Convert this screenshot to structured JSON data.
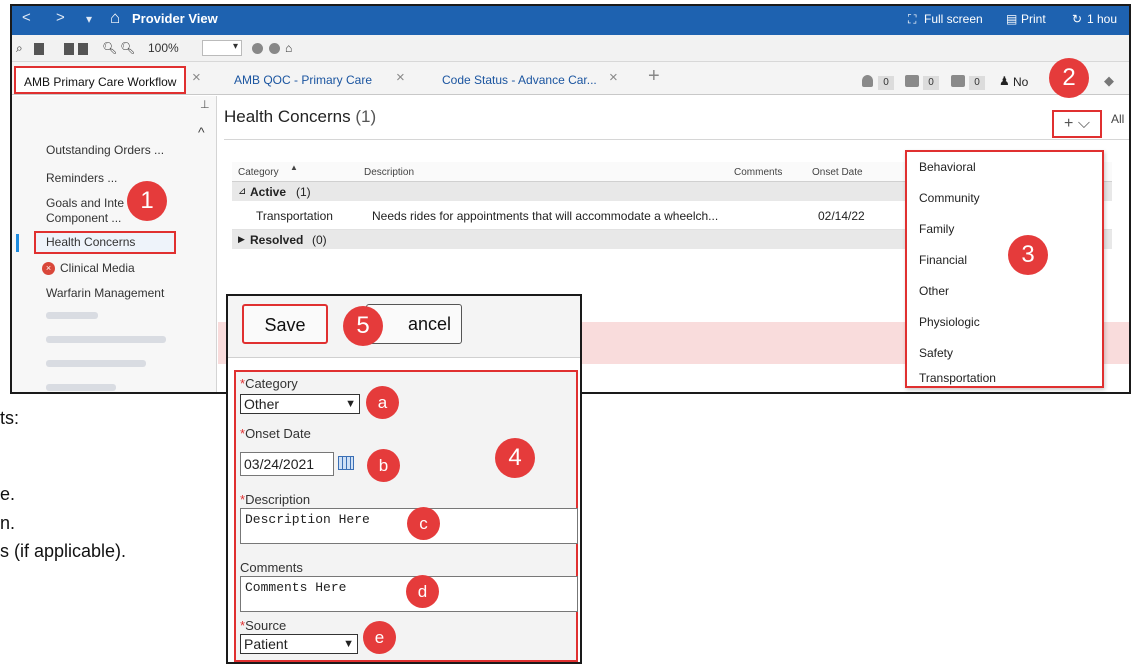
{
  "title_bar": {
    "back_glyph": "<",
    "forward_glyph": ">",
    "menu_glyph": "▾",
    "home_glyph": "⌂",
    "title": "Provider View",
    "full_screen": "Full screen",
    "print": "Print",
    "refresh": "1 hou"
  },
  "toolbar": {
    "zoom": "100%"
  },
  "tabs": [
    {
      "label": "AMB Primary Care Workflow",
      "active": true
    },
    {
      "label": "AMB QOC - Primary Care",
      "active": false
    },
    {
      "label": "Code Status - Advance Car...",
      "active": false
    }
  ],
  "tab_close": "×",
  "tab_add": "+",
  "notifications": [
    {
      "icon": "bell-icon",
      "count": "0"
    },
    {
      "icon": "message-icon",
      "count": "0"
    },
    {
      "icon": "inbox-icon",
      "count": "0"
    }
  ],
  "user_truncated": "No",
  "left_nav": {
    "pin_glyph": "⊥",
    "collapse_glyph": "^",
    "items": [
      "Outstanding Orders ...",
      "Reminders ...",
      "Goals and Inte",
      "Component ...",
      "Health Concerns",
      "Clinical Media",
      "Warfarin Management"
    ]
  },
  "health_concerns": {
    "title": "Health Concerns",
    "count": "(1)",
    "add_glyph": "+ ⌵",
    "filter": "All",
    "columns": [
      "Category",
      "Description",
      "Comments",
      "Onset Date"
    ],
    "active_group": {
      "label": "Active",
      "count": "(1)"
    },
    "row": {
      "category": "Transportation",
      "description": "Needs rides for appointments that will accommodate a wheelch...",
      "comments": "",
      "onset": "02/14/22"
    },
    "resolved_group": {
      "label": "Resolved",
      "count": "(0)"
    }
  },
  "dropdown_items": [
    "Behavioral",
    "Community",
    "Family",
    "Financial",
    "Other",
    "Physiologic",
    "Safety",
    "Transportation"
  ],
  "form": {
    "save": "Save",
    "cancel": "ancel",
    "category_label": "Category",
    "category_value": "Other",
    "onset_label": "Onset Date",
    "onset_value": "03/24/2021",
    "description_label": "Description",
    "description_value": "Description Here",
    "comments_label": "Comments",
    "comments_value": "Comments Here",
    "source_label": "Source",
    "source_value": "Patient",
    "required_mark": "*"
  },
  "callouts": [
    "1",
    "2",
    "3",
    "4",
    "5",
    "a",
    "b",
    "c",
    "d",
    "e"
  ],
  "background_text": [
    "ts:",
    "e.",
    "n.",
    "s (if applicable)."
  ],
  "colors": {
    "title_bar": "#1e62b0",
    "callout": "#e53b3b",
    "highlight_border": "#e03030",
    "link": "#1b55a0"
  }
}
